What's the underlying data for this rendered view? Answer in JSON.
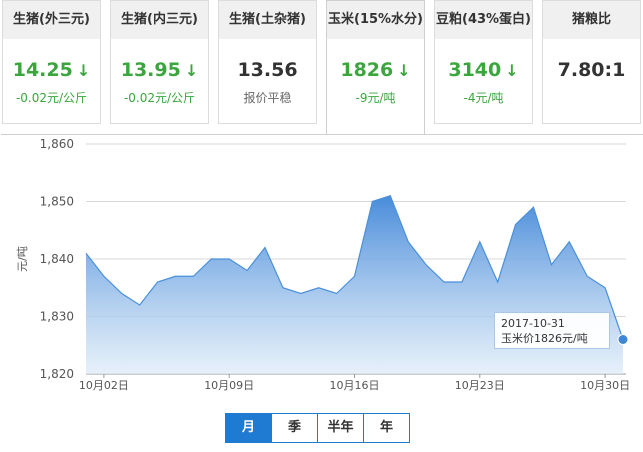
{
  "cards": [
    {
      "head": "生猪(外三元)",
      "price": "14.25",
      "change": "-0.02元/公斤",
      "arrow": "↓"
    },
    {
      "head": "生猪(内三元)",
      "price": "13.95",
      "change": "-0.02元/公斤",
      "arrow": "↓"
    },
    {
      "head": "生猪(土杂猪)",
      "price": "13.56",
      "change": "报价平稳",
      "arrow": ""
    },
    {
      "head": "玉米(15%水分)",
      "price": "1826",
      "change": "-9元/吨",
      "arrow": "↓"
    },
    {
      "head": "豆粕(43%蛋白)",
      "price": "3140",
      "change": "-4元/吨",
      "arrow": "↓"
    },
    {
      "head": "猪粮比",
      "price": "7.80:1",
      "change": "",
      "arrow": ""
    }
  ],
  "colors": {
    "up_down_green": "#3aa63d",
    "line_blue": "#4a90d9",
    "tab_blue": "#1f7bd2"
  },
  "tooltip": {
    "date": "2017-10-31",
    "value_text": "玉米价1826元/吨"
  },
  "tabs": [
    "月",
    "季",
    "半年",
    "年"
  ],
  "chart_data": {
    "type": "area",
    "title": "",
    "ylabel": "元/吨",
    "xlabel": "",
    "ylim": [
      1820,
      1860
    ],
    "yticks": [
      "1,820",
      "1,830",
      "1,840",
      "1,850",
      "1,860"
    ],
    "xtick_labels": [
      "10月02日",
      "10月09日",
      "10月16日",
      "10月23日",
      "10月30日"
    ],
    "x": [
      "10-01",
      "10-02",
      "10-03",
      "10-04",
      "10-05",
      "10-06",
      "10-07",
      "10-08",
      "10-09",
      "10-10",
      "10-11",
      "10-12",
      "10-13",
      "10-14",
      "10-15",
      "10-16",
      "10-17",
      "10-18",
      "10-19",
      "10-20",
      "10-21",
      "10-22",
      "10-23",
      "10-24",
      "10-25",
      "10-26",
      "10-27",
      "10-28",
      "10-29",
      "10-30",
      "10-31"
    ],
    "series": [
      {
        "values": [
          1841,
          1837,
          1834,
          1832,
          1836,
          1837,
          1837,
          1840,
          1840,
          1838,
          1842,
          1835,
          1834,
          1835,
          1834,
          1837,
          1850,
          1851,
          1843,
          1839,
          1836,
          1836,
          1843,
          1836,
          1846,
          1849,
          1839,
          1843,
          1837,
          1835,
          1826
        ]
      }
    ],
    "grid": true
  }
}
